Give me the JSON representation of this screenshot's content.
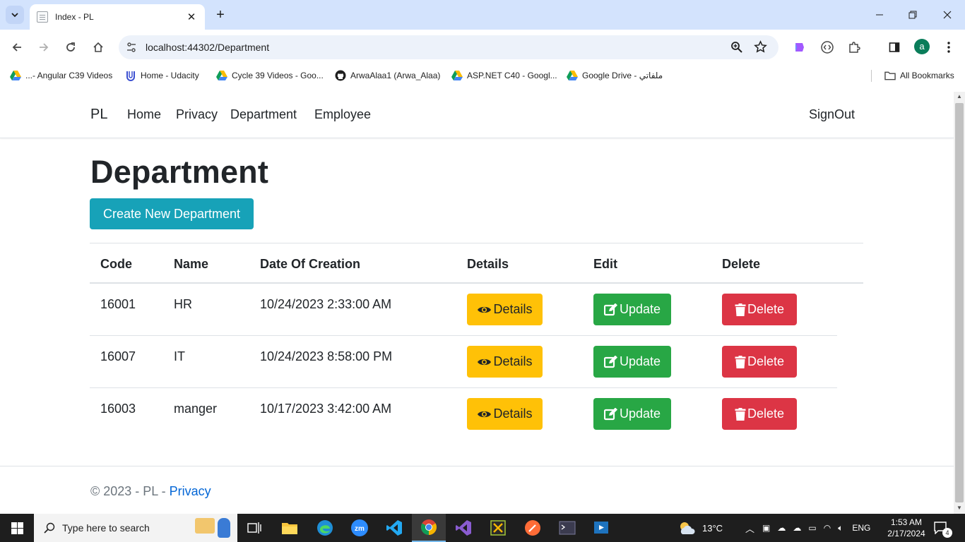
{
  "browser": {
    "tab_title": "Index - PL",
    "url": "localhost:44302/Department",
    "avatar_letter": "a",
    "bookmarks": [
      "...- Angular C39 Videos",
      "Home - Udacity",
      "Cycle 39 Videos - Goo...",
      "ArwaAlaa1 (Arwa_Alaa)",
      "ASP.NET C40 - Googl...",
      "Google Drive - ملفاتي"
    ],
    "all_bookmarks": "All Bookmarks"
  },
  "nav": {
    "brand": "PL",
    "links": [
      "Home",
      "Privacy",
      "Department",
      "Employee"
    ],
    "signout": "SignOut"
  },
  "page": {
    "title": "Department",
    "create_button": "Create New Department"
  },
  "table": {
    "headers": [
      "Code",
      "Name",
      "Date Of Creation",
      "Details",
      "Edit",
      "Delete"
    ],
    "rows": [
      {
        "code": "16001",
        "name": "HR",
        "date": "10/24/2023 2:33:00 AM"
      },
      {
        "code": "16007",
        "name": "IT",
        "date": "10/24/2023 8:58:00 PM"
      },
      {
        "code": "16003",
        "name": "manger",
        "date": "10/17/2023 3:42:00 AM"
      }
    ],
    "details_label": "Details",
    "update_label": "Update",
    "delete_label": "Delete"
  },
  "footer": {
    "prefix": "© 2023 - PL - ",
    "link": "Privacy"
  },
  "taskbar": {
    "search_placeholder": "Type here to search",
    "weather": "13°C",
    "language": "ENG",
    "time": "1:53 AM",
    "date": "2/17/2024",
    "notification_count": "4"
  },
  "colors": {
    "info": "#17a2b8",
    "warning": "#ffc107",
    "success": "#28a745",
    "danger": "#dc3545",
    "link": "#0366d6"
  }
}
